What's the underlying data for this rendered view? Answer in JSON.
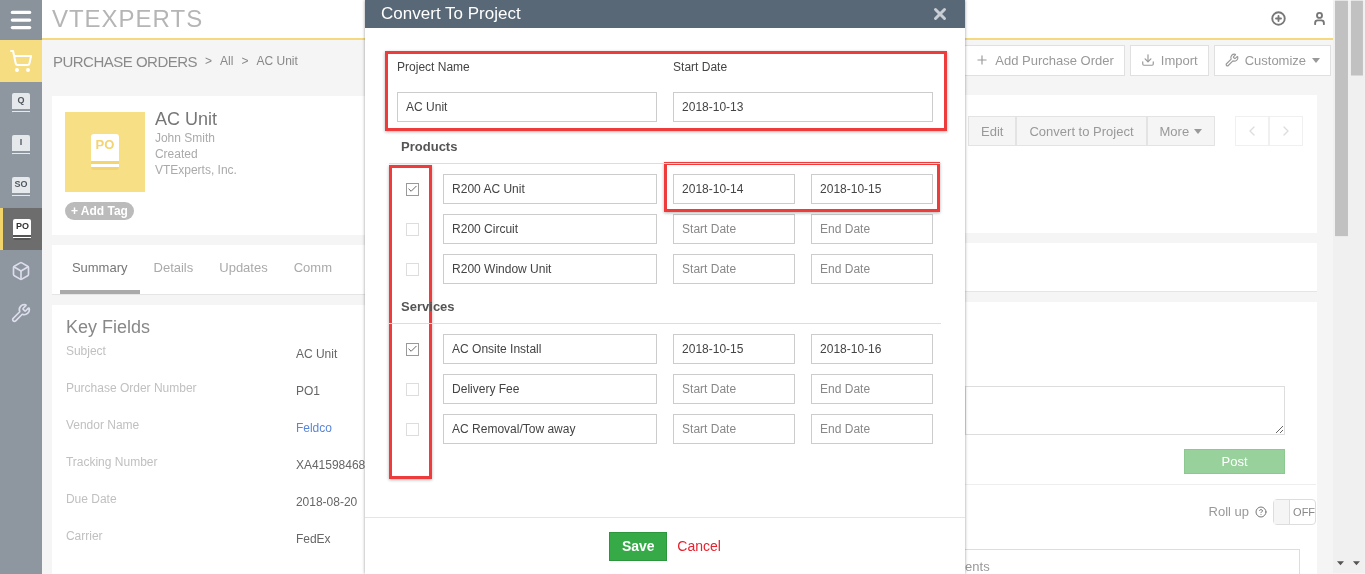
{
  "sidebar": {
    "items": [
      {
        "kind": "menu",
        "selected": false
      },
      {
        "kind": "cart",
        "selected": false
      },
      {
        "kind": "doc",
        "label": "Q",
        "selected": false
      },
      {
        "kind": "doc",
        "label": "I",
        "selected": false
      },
      {
        "kind": "doc",
        "label": "SO",
        "selected": false
      },
      {
        "kind": "doc",
        "label": "PO",
        "selected": true
      },
      {
        "kind": "box",
        "selected": false
      },
      {
        "kind": "tools",
        "selected": false
      }
    ]
  },
  "logo": "VTEXPERTS",
  "breadcrumb": {
    "module": "PURCHASE ORDERS",
    "separator": ">",
    "items": [
      "All",
      "AC Unit"
    ]
  },
  "header_buttons": [
    {
      "kind": "add",
      "label": "Add Purchase Order"
    },
    {
      "kind": "import",
      "label": "Import"
    },
    {
      "kind": "customize",
      "label": "Customize"
    }
  ],
  "record": {
    "icon_label": "PO",
    "title": "AC Unit",
    "lines": [
      "John Smith",
      "Created",
      "VTExperts, Inc."
    ],
    "tag_button": "+ Add Tag"
  },
  "record_actions": [
    {
      "label": "Edit",
      "dropdown": false
    },
    {
      "label": "Convert to Project",
      "dropdown": false
    },
    {
      "label": "More",
      "dropdown": true
    }
  ],
  "tabs": [
    {
      "label": "Summary",
      "selected": true
    },
    {
      "label": "Details",
      "selected": false
    },
    {
      "label": "Updates",
      "selected": false
    },
    {
      "label": "Comm",
      "selected": false
    }
  ],
  "key_fields": {
    "title": "Key Fields",
    "rows": [
      {
        "label": "Subject",
        "value": "AC Unit",
        "kind": "text"
      },
      {
        "label": "Purchase Order Number",
        "value": "PO1",
        "kind": "text"
      },
      {
        "label": "Vendor Name",
        "value": "Feldco",
        "kind": "link"
      },
      {
        "label": "Tracking Number",
        "value": "XA41598468",
        "kind": "text"
      },
      {
        "label": "Due Date",
        "value": "2018-08-20",
        "kind": "text"
      },
      {
        "label": "Carrier",
        "value": "FedEx",
        "kind": "text"
      }
    ]
  },
  "comments": {
    "post_button": "Post",
    "rollup_label": "Roll up",
    "rollup_toggle": {
      "label": "OFF",
      "on": false
    },
    "panel_text": "ents"
  },
  "dialog": {
    "title": "Convert To Project",
    "project_name": {
      "label": "Project Name",
      "value": "AC Unit"
    },
    "start_date": {
      "label": "Start Date",
      "value": "2018-10-13"
    },
    "sections": [
      {
        "title": "Products",
        "rows": [
          {
            "name": "R200 AC Unit",
            "checked": true,
            "start": "2018-10-14",
            "end": "2018-10-15"
          },
          {
            "name": "R200 Circuit",
            "checked": false,
            "start_placeholder": "Start Date",
            "end_placeholder": "End Date"
          },
          {
            "name": "R200 Window Unit",
            "checked": false,
            "start_placeholder": "Start Date",
            "end_placeholder": "End Date"
          }
        ]
      },
      {
        "title": "Services",
        "rows": [
          {
            "name": "AC Onsite Install",
            "checked": true,
            "start": "2018-10-15",
            "end": "2018-10-16"
          },
          {
            "name": "Delivery Fee",
            "checked": false,
            "start_placeholder": "Start Date",
            "end_placeholder": "End Date"
          },
          {
            "name": "AC Removal/Tow away",
            "checked": false,
            "start_placeholder": "Start Date",
            "end_placeholder": "End Date"
          }
        ]
      }
    ],
    "save_button": "Save",
    "cancel_link": "Cancel"
  },
  "highlight_frames": [
    {
      "kind": "project_fields"
    },
    {
      "kind": "checkbox_column"
    },
    {
      "kind": "first_product_dates"
    }
  ]
}
